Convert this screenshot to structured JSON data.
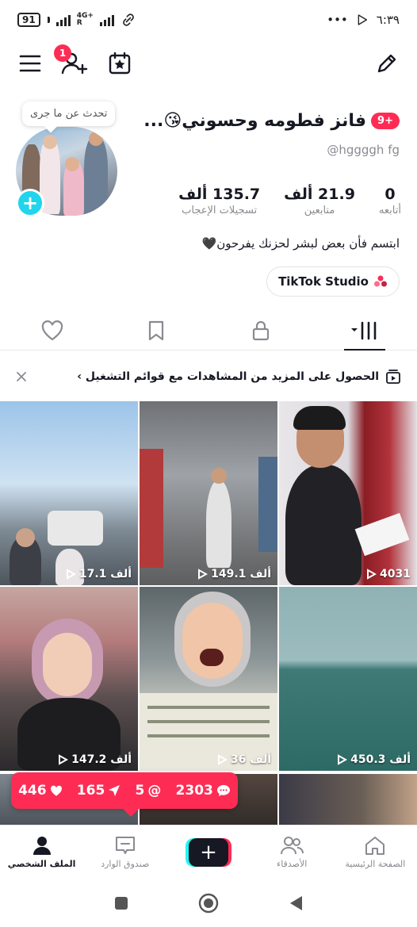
{
  "status_bar": {
    "time": "٦:٣٩",
    "battery": "91",
    "network": "4G+",
    "network_sub": "R",
    "more": "•••"
  },
  "top_bar": {
    "notification_count": "1"
  },
  "profile": {
    "bubble": "تحدث عن ما جرى",
    "name_badge": "9+",
    "display_name": "فانز فطومه وحسوني😘...",
    "username": "@hggggh fg",
    "stats": [
      {
        "value": "0",
        "label": "أتابعه"
      },
      {
        "value": "21.9 ألف",
        "label": "متابعين"
      },
      {
        "value": "135.7 ألف",
        "label": "تسجيلات الإعجاب"
      }
    ],
    "bio": "ابتسم فأن بعض لبشر لحزنك يفرحون🖤",
    "studio_button": "TikTok Studio"
  },
  "banner": {
    "text": "الحصول على المزيد من المشاهدات مع قوائم التشغيل ›"
  },
  "videos": [
    {
      "views": "17.1 ألف"
    },
    {
      "views": "149.1 ألف"
    },
    {
      "views": "4031"
    },
    {
      "views": "147.2 ألف"
    },
    {
      "views": "36 ألف"
    },
    {
      "views": "450.3 ألف"
    }
  ],
  "engagement": {
    "likes": "446",
    "shares": "165",
    "mentions": "5",
    "comments": "2303"
  },
  "bottom_nav": {
    "profile": "الملف الشخصي",
    "inbox": "صندوق الوارد",
    "create": "+",
    "friends": "الأصدقاء",
    "home": "الصفحة الرئيسية"
  },
  "colors": {
    "accent": "#fe2c55",
    "cyan": "#20d5ec",
    "text": "#161823",
    "muted": "#8a8b91"
  }
}
